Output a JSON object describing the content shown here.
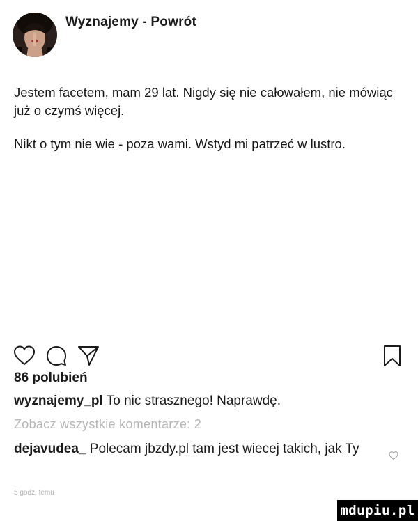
{
  "header": {
    "title": "Wyznajemy - Powrót"
  },
  "post": {
    "paragraphs": [
      "Jestem facetem, mam 29 lat. Nigdy się nie całowałem, nie mówiąc już o czymś więcej.",
      "Nikt o tym nie wie - poza wami. Wstyd mi patrzeć w lustro."
    ]
  },
  "actions": {
    "icons": [
      "heart-icon",
      "comment-icon",
      "send-icon",
      "bookmark-icon"
    ]
  },
  "likes": "86 polubień",
  "comments": [
    {
      "user": "wyznajemy_pl",
      "text": "To nic strasznego! Naprawdę."
    },
    {
      "user": "dejavudea_",
      "text": "Polecam jbzdy.pl tam jest wiecej takich, jak Ty"
    }
  ],
  "view_all": "Zobacz wszystkie komentarze: 2",
  "timestamp": "5 godz. temu",
  "watermark": "mdupiu.pl",
  "colors": {
    "text": "#1a1a1a",
    "muted": "#b5b5b5",
    "watermark_bg": "#000000"
  }
}
